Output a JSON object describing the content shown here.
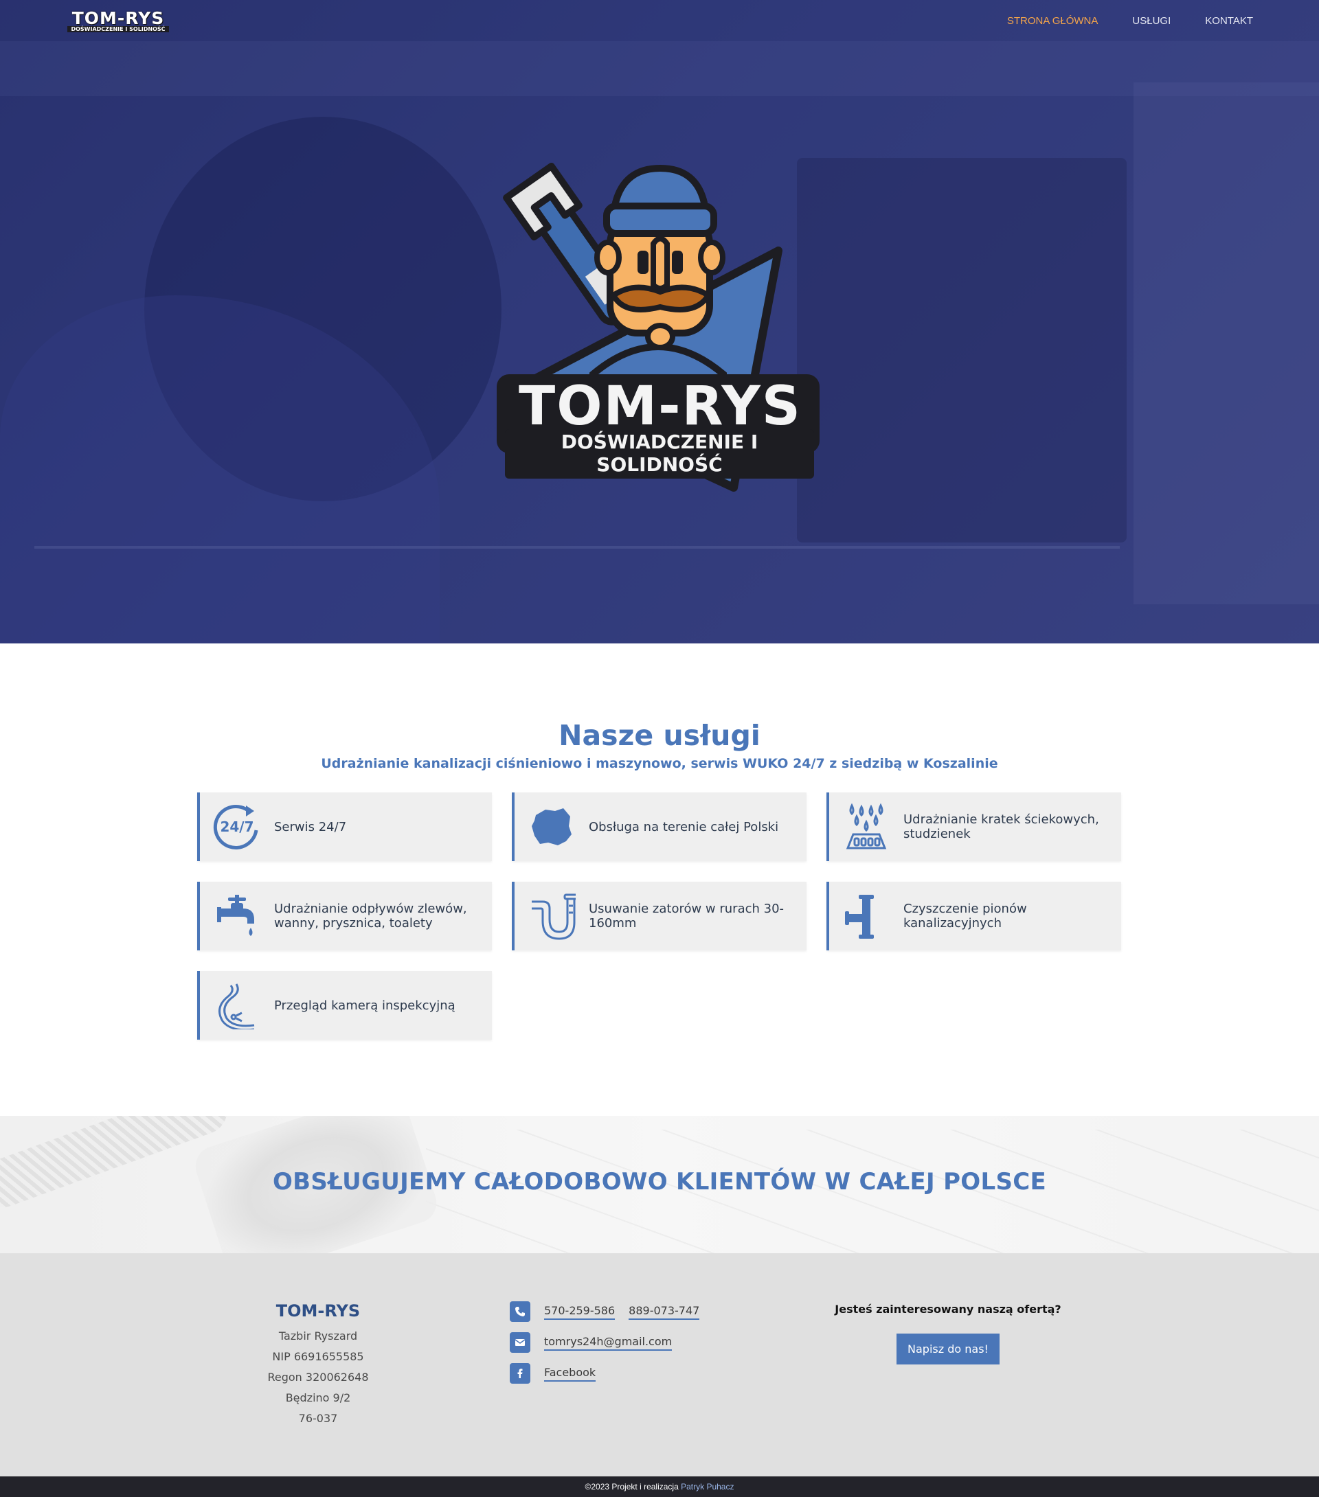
{
  "nav": {
    "logo_main": "TOM-RYS",
    "logo_sub": "DOŚWIADCZENIE I SOLIDNOŚĆ",
    "links": [
      {
        "label": "STRONA GŁÓWNA",
        "active": true
      },
      {
        "label": "USŁUGI",
        "active": false
      },
      {
        "label": "KONTAKT",
        "active": false
      }
    ]
  },
  "hero": {
    "logo_title": "TOM-RYS",
    "logo_subtitle": "DOŚWIADCZENIE I SOLIDNOŚĆ"
  },
  "services": {
    "title": "Nasze usługi",
    "subtitle": "Udrażnianie kanalizacji ciśnieniowo i maszynowo, serwis WUKO 24/7 z siedzibą w Koszalinie",
    "items": [
      {
        "icon": "clock-24-7-icon",
        "label": "Serwis 24/7"
      },
      {
        "icon": "poland-map-icon",
        "label": "Obsługa na terenie całej Polski"
      },
      {
        "icon": "drain-grate-icon",
        "label": "Udrażnianie kratek ściekowych, studzienek"
      },
      {
        "icon": "faucet-icon",
        "label": "Udrażnianie odpływów zlewów, wanny, prysznica, toalety"
      },
      {
        "icon": "pipe-trap-icon",
        "label": "Usuwanie zatorów w rurach 30-160mm"
      },
      {
        "icon": "vertical-pipe-icon",
        "label": "Czyszczenie pionów kanalizacyjnych"
      },
      {
        "icon": "inspection-camera-icon",
        "label": "Przegląd kamerą inspekcyjną"
      }
    ]
  },
  "banner": {
    "text": "OBSŁUGUJEMY CAŁODOBOWO KLIENTÓW W CAŁEJ POLSCE"
  },
  "footer": {
    "company": {
      "name": "TOM-RYS",
      "lines": [
        "Tazbir Ryszard",
        "NIP 6691655585",
        "Regon 320062648",
        "Będzino 9/2",
        "76-037"
      ]
    },
    "contact": {
      "phone1": "570-259-586",
      "phone2": "889-073-747",
      "email": "tomrys24h@gmail.com",
      "facebook": "Facebook"
    },
    "offer": {
      "question": "Jesteś zainteresowany naszą ofertą?",
      "button": "Napisz do nas!"
    }
  },
  "copyright": {
    "text": "©2023 Projekt i realizacja",
    "author": "Patryk Puhacz"
  },
  "colors": {
    "brand_blue": "#4a76b8",
    "nav_active": "#f5a54a",
    "hero_navy": "#353f80"
  }
}
